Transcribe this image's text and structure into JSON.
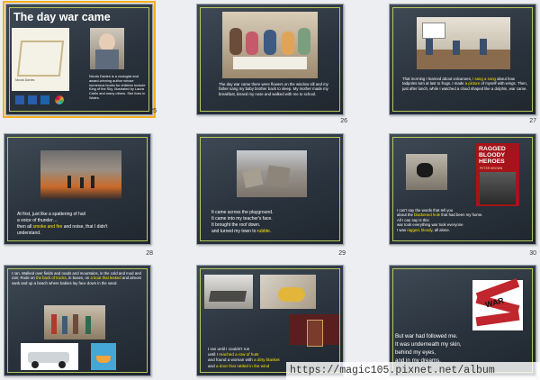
{
  "slides": [
    {
      "number": "25",
      "title": "The day war came",
      "author_bio": "Nicola Davies is a zoologist and award-winning author whose numerous books for children include King of the Sky, illustrated by Laura Carlin and many others. She lives in Wales.",
      "book_cover_text": "Nicola Davies"
    },
    {
      "number": "26",
      "text": "The day war came there were flowers on the window sill and my father sang my baby brother back to sleep. My mother made my breakfast, kissed my nose and walked with me to school."
    },
    {
      "number": "27",
      "text_before": "That morning I learned about volcanoes, ",
      "text_hl1": "I sang a song",
      "text_mid": " about how tadpoles turn at last to frogs. I made ",
      "text_hl2": "a picture",
      "text_after": " of myself with wings. Then, just after lunch, while I watched a cloud shaped like a dolphin, war came."
    },
    {
      "number": "28",
      "line1": "At first, just like a spattering of hail",
      "line2": "a voice of thunder…",
      "line3_before": "then all ",
      "line3_hl": "smoke and fire",
      "line3_after": " and noise, that I didn't",
      "line4": "understand."
    },
    {
      "number": "29",
      "line1": "It came across the playground.",
      "line2": "It came into my teacher's face.",
      "line3": "It brought the roof down.",
      "line4_before": "and turned my town to ",
      "line4_hl": "rubble",
      "line4_after": "."
    },
    {
      "number": "30",
      "book_title": "RAGGED BLOODY HEROES",
      "book_author": "PETER BROWN",
      "line1": "I can't say the words that tell you",
      "line2_before": "about the ",
      "line2_hl": "blackened hole",
      "line2_after": " that had been my home.",
      "line3": "All I can say is this:",
      "line4": "war took everything   war took everyone",
      "line5_before": "I was ",
      "line5_hl1": "ragged",
      "line5_mid": ", ",
      "line5_hl2": "bloody",
      "line5_after": ", all alone."
    },
    {
      "text_before": "I ran. Walked over fields and roads and mountains, in the cold and mud and rain; Rode on ",
      "text_hl1": "the back of trucks",
      "text_mid": ", in buses, on ",
      "text_hl2": "a boat that leaked",
      "text_after": " and almost sank and up a beach where babies lay face down in the sand."
    },
    {
      "line1": "I ran until I couldn't run",
      "line2_before": "until ",
      "line2_hl": "I reached a row of huts",
      "line3_before": "and found a woman with ",
      "line3_hl": "a dirty blanket",
      "line4_before": "and ",
      "line4_hl": "a door that rattled in the wind"
    },
    {
      "line1": "But war had followed me.",
      "line2": "It was underneath my skin,",
      "line3": "behind my eyes,",
      "line4": "and in my dreams.",
      "poster_word": "WAR"
    }
  ],
  "watermark": "https://magic105.pixnet.net/album",
  "colors": {
    "selection": "#f2b01e",
    "highlight": "#ffe600",
    "inner_border": "#b7c85a"
  }
}
